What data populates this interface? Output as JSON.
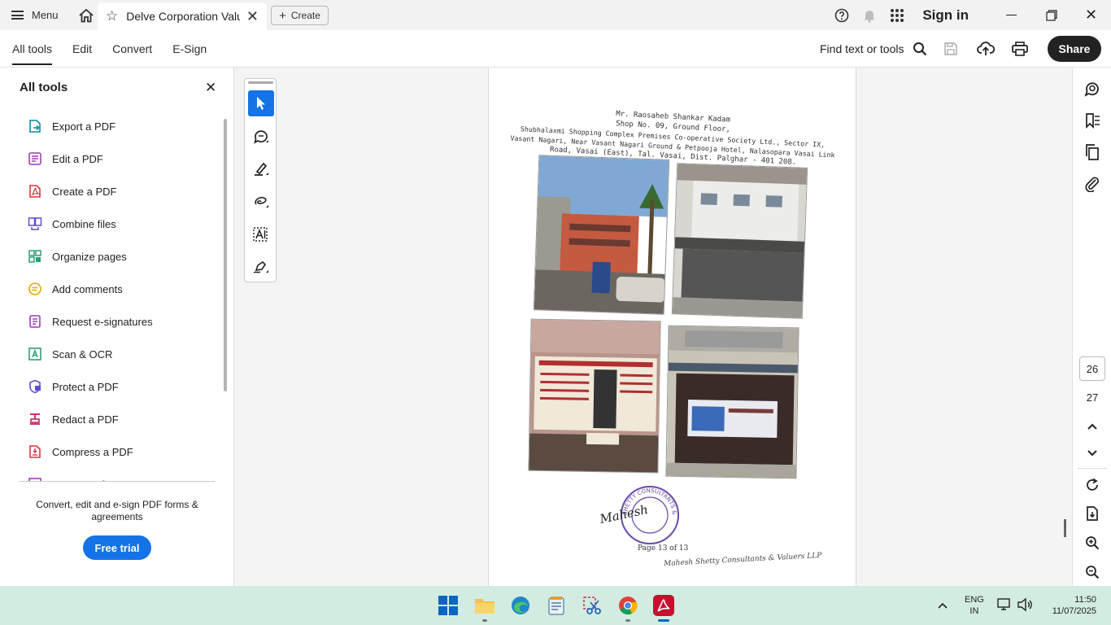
{
  "titlebar": {
    "menu_label": "Menu",
    "tab_title": "Delve Corporation Valua...",
    "create_label": "Create",
    "sign_in": "Sign in"
  },
  "toolbar": {
    "nav": [
      "All tools",
      "Edit",
      "Convert",
      "E-Sign"
    ],
    "active_nav": "All tools",
    "find_label": "Find text or tools",
    "share_label": "Share"
  },
  "panel": {
    "title": "All tools",
    "tools": [
      {
        "label": "Export a PDF",
        "icon": "export-pdf-icon",
        "color": "#0f8a9e"
      },
      {
        "label": "Edit a PDF",
        "icon": "edit-pdf-icon",
        "color": "#9b3fb5"
      },
      {
        "label": "Create a PDF",
        "icon": "create-pdf-icon",
        "color": "#d7373f"
      },
      {
        "label": "Combine files",
        "icon": "combine-files-icon",
        "color": "#5a4fcf"
      },
      {
        "label": "Organize pages",
        "icon": "organize-pages-icon",
        "color": "#2d9d78"
      },
      {
        "label": "Add comments",
        "icon": "add-comments-icon",
        "color": "#e6a700"
      },
      {
        "label": "Request e-signatures",
        "icon": "request-esign-icon",
        "color": "#9b3fb5"
      },
      {
        "label": "Scan & OCR",
        "icon": "scan-ocr-icon",
        "color": "#2d9d78"
      },
      {
        "label": "Protect a PDF",
        "icon": "protect-pdf-icon",
        "color": "#5a4fcf"
      },
      {
        "label": "Redact a PDF",
        "icon": "redact-pdf-icon",
        "color": "#c2185b"
      },
      {
        "label": "Compress a PDF",
        "icon": "compress-pdf-icon",
        "color": "#d7373f"
      },
      {
        "label": "Prepare a form",
        "icon": "prepare-form-icon",
        "color": "#9b3fb5"
      }
    ],
    "footer_text": "Convert, edit and e-sign PDF forms & agreements",
    "trial_label": "Free trial"
  },
  "document": {
    "header_lines": [
      "Mr. Raosaheb Shankar Kadam",
      "Shop No. 09, Ground Floor,",
      "Shubhalaxmi Shopping Complex Premises Co-operative Society Ltd., Sector IX,",
      "Vasant Nagari, Near Vasant Nagari Ground & Petpooja Hotel, Nalasopara Vasai Link",
      "Road, Vasai (East), Tal. Vasai, Dist. Palghar - 401 208."
    ],
    "page_label": "Page 13 of 13",
    "firm_signature": "Mahesh Shetty Consultants & Valuers LLP",
    "stamp_text": "SHETTY CONSULTANTS & VALUERS",
    "sign_text": "Mahesh"
  },
  "rail": {
    "page_current": "26",
    "page_next": "27"
  },
  "taskbar": {
    "lang_1": "ENG",
    "lang_2": "IN",
    "time": "11:50",
    "date": "11/07/2025"
  }
}
